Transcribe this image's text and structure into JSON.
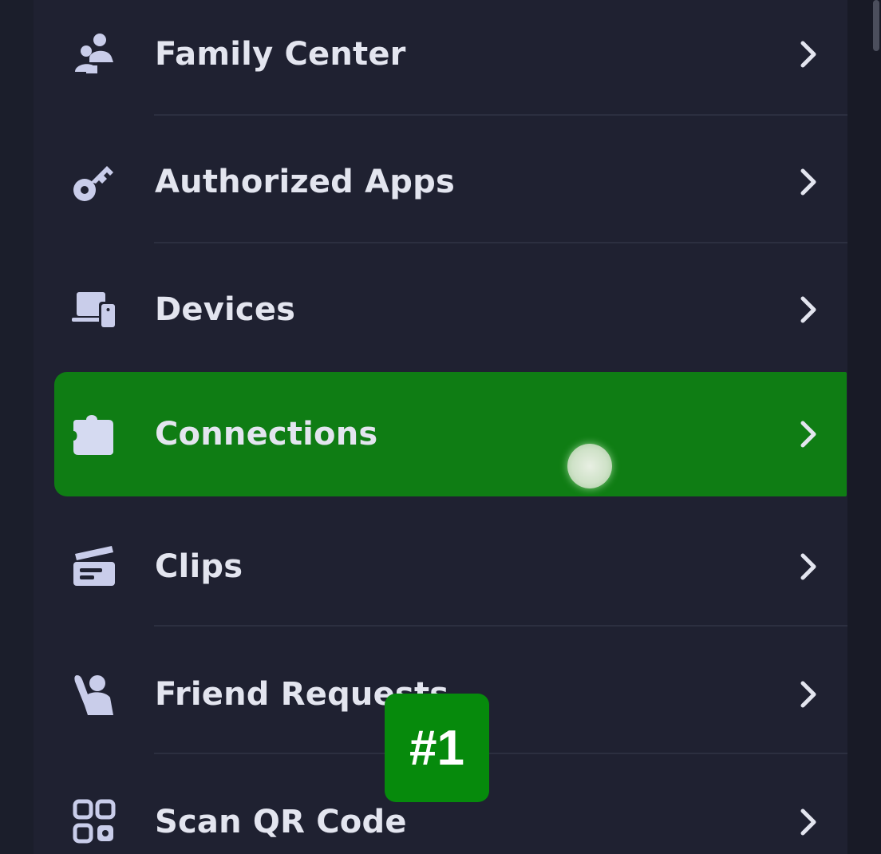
{
  "menu": {
    "items": [
      {
        "label": "Family Center",
        "icon": "family-icon"
      },
      {
        "label": "Authorized Apps",
        "icon": "key-icon"
      },
      {
        "label": "Devices",
        "icon": "devices-icon"
      },
      {
        "label": "Connections",
        "icon": "puzzle-icon",
        "selected": true
      },
      {
        "label": "Clips",
        "icon": "clapperboard-icon"
      },
      {
        "label": "Friend Requests",
        "icon": "wave-person-icon"
      },
      {
        "label": "Scan QR Code",
        "icon": "qr-scan-icon"
      }
    ]
  },
  "annotation": {
    "step_label": "#1"
  },
  "colors": {
    "background": "#1f2131",
    "highlight": "#0f7d14",
    "badge": "#068a0c",
    "text": "#e3e5ef",
    "icon": "#c9cdea"
  }
}
